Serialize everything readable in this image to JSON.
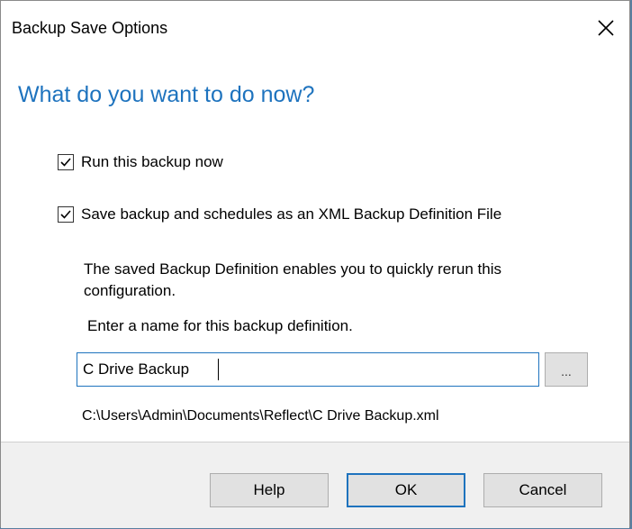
{
  "window": {
    "title": "Backup Save Options",
    "close_icon": "close-icon"
  },
  "heading": "What do you want to do now?",
  "options": [
    {
      "label": "Run this backup now",
      "checked": true
    },
    {
      "label": "Save backup and schedules as an XML Backup Definition File",
      "checked": true
    }
  ],
  "description": "The saved Backup Definition enables you to quickly rerun this configuration.",
  "name_prompt": "Enter a name for this backup definition.",
  "name_input": {
    "value": "C Drive Backup"
  },
  "browse_label": "...",
  "file_path": "C:\\Users\\Admin\\Documents\\Reflect\\C Drive Backup.xml",
  "buttons": {
    "help": "Help",
    "ok": "OK",
    "cancel": "Cancel"
  },
  "colors": {
    "accent": "#1e73be",
    "footer": "#f0f0f0",
    "button": "#e1e1e1"
  }
}
